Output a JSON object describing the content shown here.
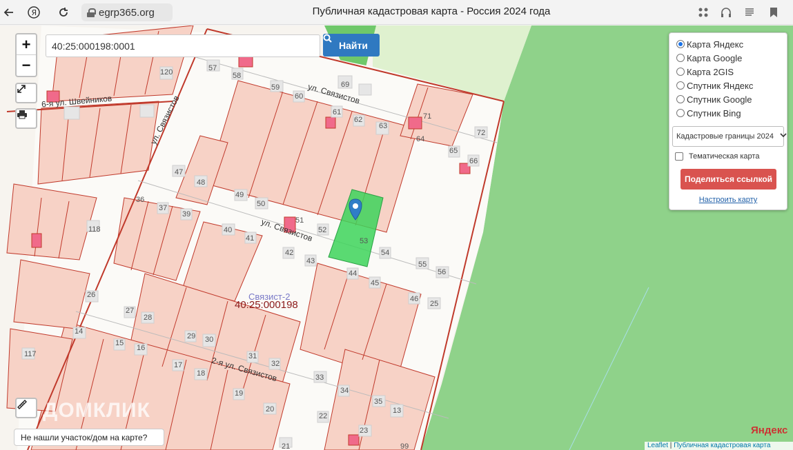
{
  "browser": {
    "url": "egrp365.org",
    "page_title": "Публичная кадастровая карта - Россия 2024 года"
  },
  "search": {
    "value": "40:25:000198:0001",
    "button_label": "Найти"
  },
  "zoom": {
    "in": "+",
    "out": "−"
  },
  "layers": {
    "options": [
      "Карта Яндекс",
      "Карта Google",
      "Карта 2GIS",
      "Спутник Яндекс",
      "Спутник Google",
      "Спутник Bing"
    ],
    "selected": "Карта Яндекс",
    "boundaries_select": "Кадастровые границы 2024",
    "thematic_label": "Тематическая карта",
    "share_label": "Поделиться ссылкой",
    "configure_label": "Настроить карту"
  },
  "map": {
    "quarter_label": "40:25:000198",
    "settlement_label": "Связист-2",
    "streets": [
      "ул. Связистов",
      "ул. Связистов",
      "2-я ул. Связистов",
      "6-я ул. Швейников",
      "ул. Связистов"
    ],
    "plot_numbers": [
      "57",
      "58",
      "59",
      "60",
      "61",
      "62",
      "63",
      "64",
      "65",
      "66",
      "69",
      "71",
      "72",
      "47",
      "48",
      "49",
      "50",
      "51",
      "52",
      "53",
      "54",
      "55",
      "56",
      "36",
      "37",
      "39",
      "40",
      "41",
      "42",
      "43",
      "44",
      "45",
      "46",
      "25",
      "26",
      "27",
      "28",
      "29",
      "30",
      "31",
      "32",
      "33",
      "34",
      "35",
      "13",
      "14",
      "15",
      "16",
      "17",
      "18",
      "19",
      "20",
      "21",
      "22",
      "23",
      "99",
      "117",
      "118",
      "120"
    ],
    "not_found_label": "Не нашли участок/дом на карте?",
    "watermark": "ДОМКЛИК",
    "provider_logo": "Яндекс",
    "attribution_leaflet": "Leaflet",
    "attribution_map": "Публичная кадастровая карта"
  },
  "colors": {
    "selected_plot": "#3dd35a",
    "boundary": "#c0392b",
    "forest": "#8fd28a",
    "button": "#2f79c1",
    "share": "#d9534f"
  }
}
